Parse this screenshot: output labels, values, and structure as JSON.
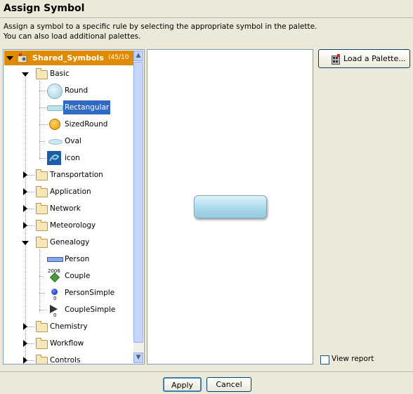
{
  "header": {
    "title": "Assign Symbol"
  },
  "description": {
    "line1": "Assign a symbol to a specific rule by selecting the appropriate symbol in the palette.",
    "line2": "You can also load additional palettes."
  },
  "tree": {
    "root": {
      "label": "Shared_Symbols",
      "count": "(45/10"
    },
    "items": [
      {
        "label": "Basic"
      },
      {
        "label": "Round"
      },
      {
        "label": "Rectangular"
      },
      {
        "label": "SizedRound"
      },
      {
        "label": "Oval"
      },
      {
        "label": "icon"
      },
      {
        "label": "Transportation"
      },
      {
        "label": "Application"
      },
      {
        "label": "Network"
      },
      {
        "label": "Meteorology"
      },
      {
        "label": "Genealogy"
      },
      {
        "label": "Person"
      },
      {
        "label": "Couple"
      },
      {
        "label": "PersonSimple"
      },
      {
        "label": "CoupleSimple"
      },
      {
        "label": "Chemistry"
      },
      {
        "label": "Workflow"
      },
      {
        "label": "Controls"
      }
    ],
    "couple_year": "2006",
    "zero": "0"
  },
  "buttons": {
    "load_palette": "Load a Palette...",
    "apply": "Apply",
    "cancel": "Cancel"
  },
  "view_report": {
    "label": "View report",
    "checked": false
  }
}
